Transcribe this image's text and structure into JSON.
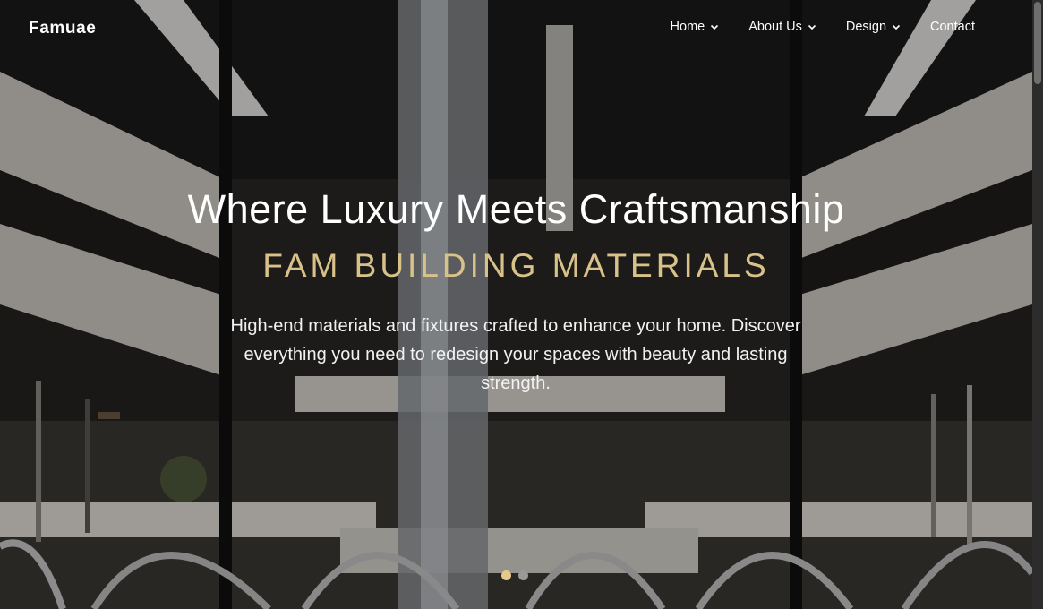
{
  "brand": "Famuae",
  "nav": {
    "items": [
      {
        "label": "Home",
        "has_dropdown": true
      },
      {
        "label": "About Us",
        "has_dropdown": true
      },
      {
        "label": "Design",
        "has_dropdown": true
      },
      {
        "label": "Contact",
        "has_dropdown": false
      }
    ]
  },
  "hero": {
    "title": "Where Luxury Meets Craftsmanship",
    "subtitle": "FAM BUILDING MATERIALS",
    "description": "High-end materials and fixtures crafted to enhance your home. Discover everything you need to redesign your spaces with beauty and lasting strength.",
    "slides": {
      "count": 2,
      "active_index": 0
    }
  },
  "colors": {
    "accent": "#d9c28a",
    "dot_active": "#e6c98c",
    "dot_inactive": "#9a9a9a",
    "text": "#ffffff"
  },
  "icons": {
    "dropdown": "chevron-down-icon"
  }
}
